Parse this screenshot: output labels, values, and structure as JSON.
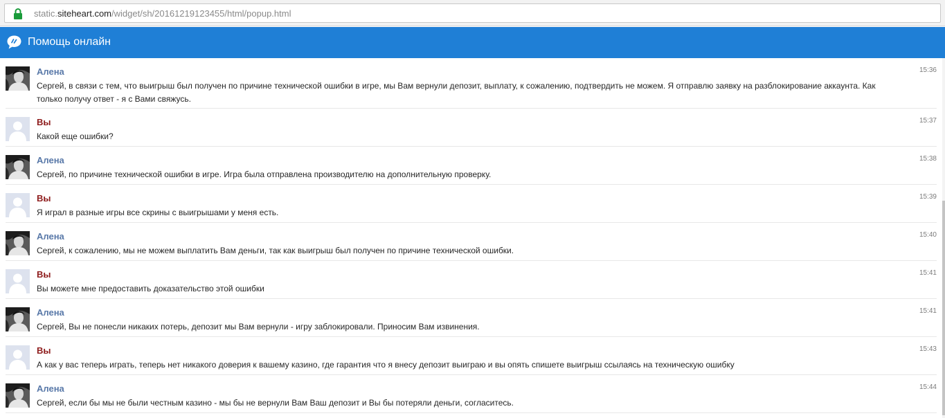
{
  "browser": {
    "url_scheme": "static.",
    "url_host": "siteheart.com",
    "url_path": "/widget/sh/20161219123455/html/popup.html"
  },
  "header": {
    "title": "Помощь онлайн"
  },
  "colors": {
    "header_bg": "#1f7fd6",
    "operator_name": "#5878a8",
    "user_name": "#8e1c1c"
  },
  "messages": [
    {
      "author": "Алена",
      "role": "operator",
      "time": "15:36",
      "text": "Сергей, в связи с тем, что выигрыш был получен по причине технической ошибки в игре, мы Вам вернули депозит, выплату, к сожалению, подтвердить не можем. Я отправлю заявку на разблокирование аккаунта. Как только получу ответ - я с Вами свяжусь."
    },
    {
      "author": "Вы",
      "role": "user",
      "time": "15:37",
      "text": "Какой еще ошибки?"
    },
    {
      "author": "Алена",
      "role": "operator",
      "time": "15:38",
      "text": "Сергей, по причине технической ошибки в игре. Игра была отправлена производителю на дополнительную проверку."
    },
    {
      "author": "Вы",
      "role": "user",
      "time": "15:39",
      "text": "Я играл в разные игры все скрины с выигрышами у меня есть."
    },
    {
      "author": "Алена",
      "role": "operator",
      "time": "15:40",
      "text": "Сергей, к сожалению, мы не можем выплатить Вам деньги, так как выигрыш был получен по причине технической ошибки."
    },
    {
      "author": "Вы",
      "role": "user",
      "time": "15:41",
      "text": "Вы можете мне предоставить доказательство этой ошибки"
    },
    {
      "author": "Алена",
      "role": "operator",
      "time": "15:41",
      "text": "Сергей, Вы не понесли никаких потерь, депозит мы Вам вернули - игру заблокировали. Приносим Вам извинения."
    },
    {
      "author": "Вы",
      "role": "user",
      "time": "15:43",
      "text": "А как у вас теперь играть, теперь нет никакого доверия к вашему казино, где гарантия что я внесу депозит выиграю и вы опять спишете выигрыш ссылаясь на техническую ошибку"
    },
    {
      "author": "Алена",
      "role": "operator",
      "time": "15:44",
      "text": "Сергей, если бы мы не были честным казино - мы бы не вернули Вам Ваш депозит и Вы бы потеряли деньги, согласитесь."
    }
  ]
}
